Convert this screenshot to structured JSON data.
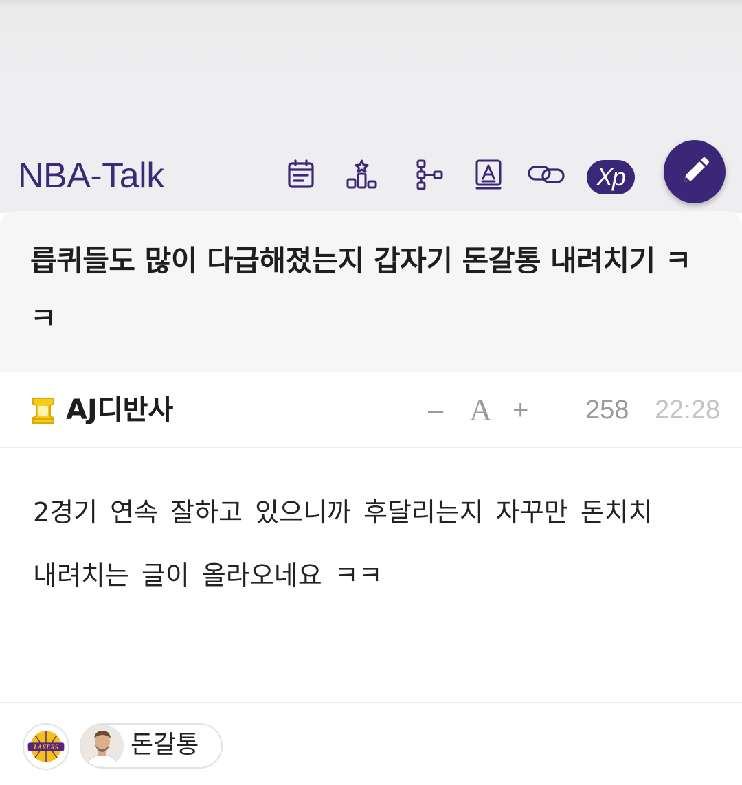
{
  "header": {
    "board_title": "NBA-Talk",
    "toolbar_icons": [
      "calendar-icon",
      "ranking-icon",
      "tree-icon",
      "dictionary-icon",
      "link-icon"
    ],
    "xp_badge": "Xp",
    "accent_color": "#3a2777"
  },
  "post": {
    "title": "릅퀴들도 많이 다급해졌는지 갑자기 돈갈통 내려치기 ㅋㅋ",
    "author": "AJ디반사",
    "font_decrease": "–",
    "font_label": "A",
    "font_increase": "+",
    "views": "258",
    "time": "22:28",
    "body_line1": "2경기 연속 잘하고 있으니까 후달리는지 자꾸만 돈치치",
    "body_line2": "내려치는 글이 올라오네요 ㅋㅋ"
  },
  "footer": {
    "team_logo_text": "LAKERS",
    "tag_label": "돈갈통"
  }
}
